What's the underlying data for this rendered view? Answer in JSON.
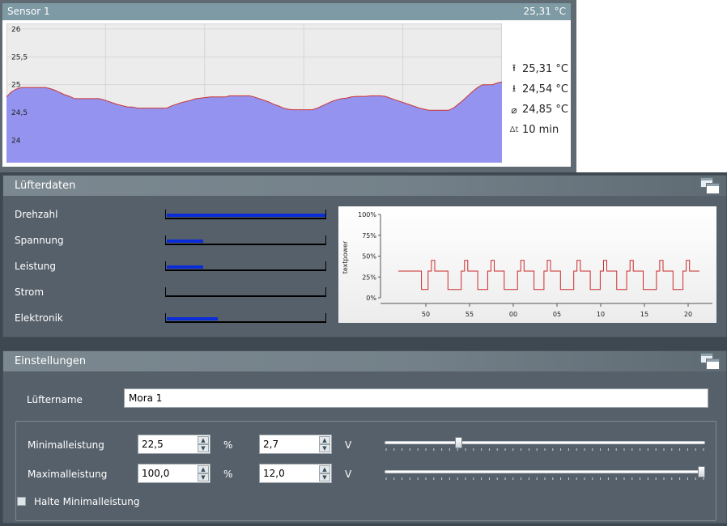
{
  "sensor": {
    "title": "Sensor 1",
    "current_value": "25,31 °C",
    "stats": [
      {
        "icon": "max-icon",
        "value": "25,31 °C"
      },
      {
        "icon": "min-icon",
        "value": "24,54 °C"
      },
      {
        "icon": "average-icon",
        "value": "24,85 °C"
      },
      {
        "icon": "delta-time-icon",
        "value": "10 min"
      }
    ],
    "chart_data": {
      "type": "area",
      "title": "",
      "xlabel": "",
      "ylabel": "",
      "ylim": [
        23.6,
        26.1
      ],
      "yticks": [
        "26",
        "25,5",
        "25",
        "24,5",
        "24"
      ],
      "grid": true,
      "fill_color": "#9494f0",
      "line_color": "#cc3333",
      "values": [
        24.78,
        24.87,
        24.92,
        24.95,
        24.95,
        24.95,
        24.95,
        24.95,
        24.95,
        24.93,
        24.9,
        24.86,
        24.82,
        24.79,
        24.75,
        24.75,
        24.75,
        24.75,
        24.75,
        24.75,
        24.73,
        24.7,
        24.67,
        24.64,
        24.62,
        24.6,
        24.6,
        24.58,
        24.58,
        24.58,
        24.58,
        24.58,
        24.58,
        24.58,
        24.62,
        24.65,
        24.68,
        24.7,
        24.72,
        24.75,
        24.76,
        24.77,
        24.78,
        24.78,
        24.78,
        24.78,
        24.8,
        24.8,
        24.8,
        24.8,
        24.8,
        24.78,
        24.75,
        24.72,
        24.69,
        24.65,
        24.62,
        24.58,
        24.56,
        24.55,
        24.55,
        24.55,
        24.55,
        24.55,
        24.58,
        24.62,
        24.66,
        24.7,
        24.73,
        24.75,
        24.76,
        24.78,
        24.79,
        24.79,
        24.79,
        24.8,
        24.8,
        24.8,
        24.79,
        24.76,
        24.73,
        24.7,
        24.67,
        24.64,
        24.61,
        24.58,
        24.56,
        24.54,
        24.54,
        24.54,
        24.54,
        24.54,
        24.58,
        24.65,
        24.72,
        24.8,
        24.88,
        24.95,
        25.0,
        25.0,
        25.0,
        25.03,
        25.05
      ]
    }
  },
  "fan": {
    "title": "Lüfterdaten",
    "metrics": [
      {
        "label": "Drehzahl",
        "fraction": 1.0
      },
      {
        "label": "Spannung",
        "fraction": 0.23
      },
      {
        "label": "Leistung",
        "fraction": 0.23
      },
      {
        "label": "Strom",
        "fraction": 0.0
      },
      {
        "label": "Elektronik",
        "fraction": 0.32
      }
    ],
    "chart_data": {
      "type": "line",
      "title": "",
      "xlabel": "",
      "ylabel": "textpower",
      "ylim": [
        0,
        100
      ],
      "yticks": [
        "100%",
        "75%",
        "50%",
        "25%",
        "0%"
      ],
      "xticks": [
        "50",
        "55",
        "00",
        "05",
        "10",
        "15",
        "20"
      ],
      "line_color": "#cc2a2a",
      "series": [
        {
          "values": [
            32,
            32,
            32,
            32,
            32,
            32,
            32,
            10,
            10,
            32,
            45,
            32,
            32,
            32,
            32,
            10,
            10,
            10,
            10,
            32,
            45,
            32,
            32,
            32,
            10,
            10,
            10,
            32,
            45,
            32,
            32,
            32,
            10,
            10,
            10,
            10,
            32,
            45,
            32,
            32,
            32,
            10,
            10,
            10,
            32,
            45,
            32,
            32,
            32,
            10,
            10,
            10,
            10,
            32,
            45,
            32,
            32,
            32,
            10,
            10,
            10,
            32,
            45,
            32,
            32,
            32,
            10,
            10,
            10,
            32,
            45,
            32,
            32,
            32,
            10,
            10,
            10,
            10,
            32,
            45,
            32,
            32,
            32,
            10,
            10,
            10,
            32,
            45,
            32,
            32,
            32,
            32
          ]
        }
      ]
    }
  },
  "settings": {
    "title": "Einstellungen",
    "fan_name_label": "Lüftername",
    "fan_name_value": "Mora 1",
    "min_label": "Minimalleistung",
    "min_percent": "22,5",
    "min_voltage": "2,7",
    "max_label": "Maximalleistung",
    "max_percent": "100,0",
    "max_voltage": "12,0",
    "unit_percent": "%",
    "unit_voltage": "V",
    "min_slider_fraction": 0.225,
    "max_slider_fraction": 1.0,
    "hold_min_label": "Halte Minimalleistung",
    "hold_min_checked": false
  }
}
